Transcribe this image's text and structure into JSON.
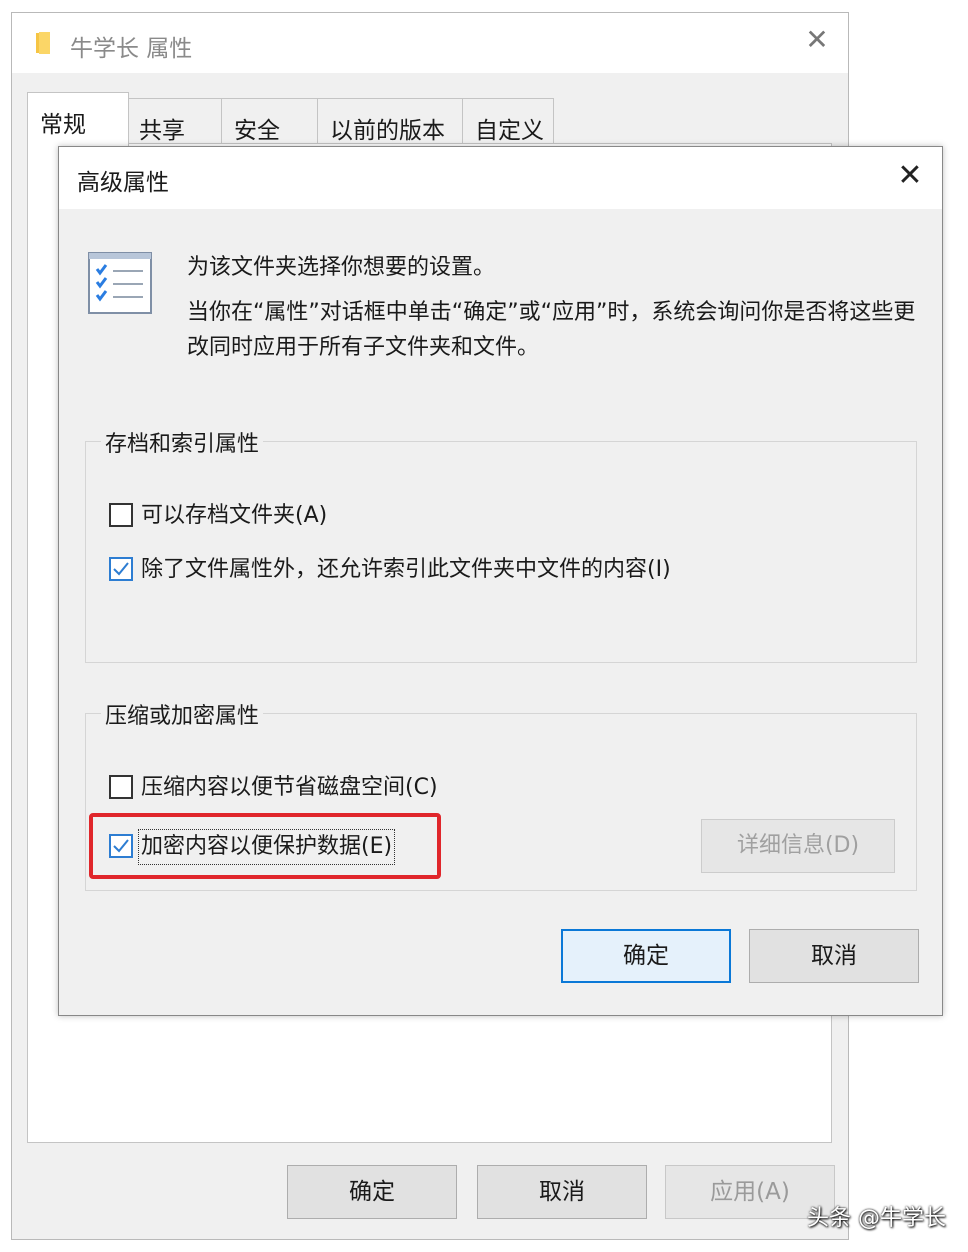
{
  "outer_window": {
    "title": "牛学长 属性",
    "close_symbol": "✕",
    "folder_icon_color": "#f6c544",
    "tabs": [
      {
        "label": "常规",
        "active": true
      },
      {
        "label": "共享",
        "active": false
      },
      {
        "label": "安全",
        "active": false
      },
      {
        "label": "以前的版本",
        "active": false
      },
      {
        "label": "自定义",
        "active": false
      }
    ],
    "buttons": {
      "ok": "确定",
      "cancel": "取消",
      "apply": "应用(A)"
    }
  },
  "dialog": {
    "title": "高级属性",
    "close_symbol": "✕",
    "intro": "为该文件夹选择你想要的设置。",
    "description": "当你在“属性”对话框中单击“确定”或“应用”时，系统会询问你是否将这些更改同时应用于所有子文件夹和文件。",
    "archive_group": {
      "label": "存档和索引属性",
      "options": [
        {
          "label": "可以存档文件夹(A)",
          "checked": false
        },
        {
          "label": "除了文件属性外，还允许索引此文件夹中文件的内容(I)",
          "checked": true
        }
      ]
    },
    "compress_group": {
      "label": "压缩或加密属性",
      "options": [
        {
          "label": "压缩内容以便节省磁盘空间(C)",
          "checked": false
        },
        {
          "label": "加密内容以便保护数据(E)",
          "checked": true
        }
      ],
      "details_button": "详细信息(D)"
    },
    "buttons": {
      "ok": "确定",
      "cancel": "取消"
    }
  },
  "colors": {
    "highlight": "#e0262b",
    "accent": "#0a78d7",
    "check": "#2d7dd2"
  },
  "watermark": "头条 @牛学长"
}
